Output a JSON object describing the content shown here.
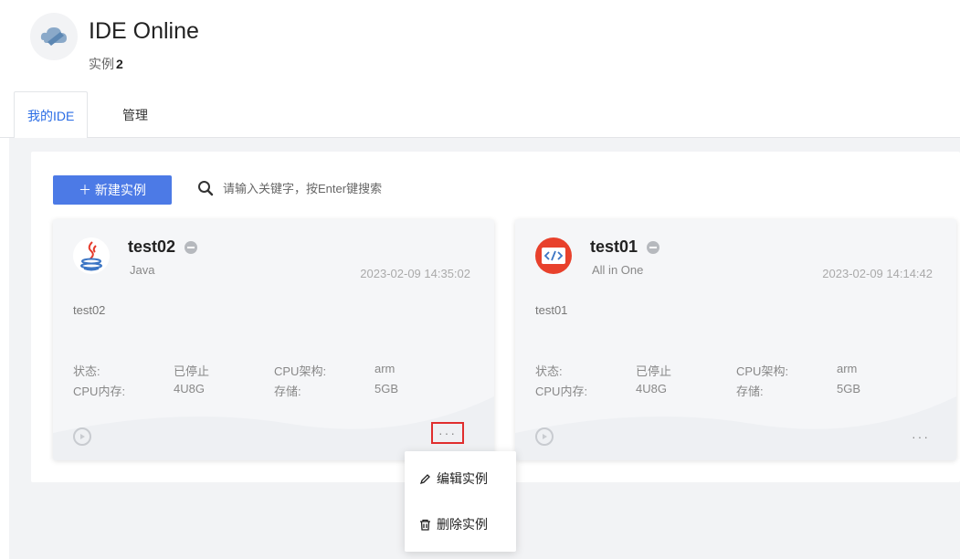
{
  "app": {
    "title": "IDE Online",
    "instances_label": "实例",
    "instances_count": "2"
  },
  "tabs": [
    {
      "label": "我的IDE"
    },
    {
      "label": "管理"
    }
  ],
  "toolbar": {
    "new_button": "＋ 新建实例",
    "search_placeholder": "请输入关键字，按Enter键搜索"
  },
  "labels": {
    "status": "状态:",
    "cpu_arch": "CPU架构:",
    "cpu_mem": "CPU内存:",
    "storage": "存储:"
  },
  "cards": [
    {
      "name": "test02",
      "type": "Java",
      "time": "2023-02-09 14:35:02",
      "desc": "test02",
      "status": "已停止",
      "cpu_arch": "arm",
      "cpu_mem": "4U8G",
      "storage": "5GB",
      "more": "···"
    },
    {
      "name": "test01",
      "type": "All in One",
      "time": "2023-02-09 14:14:42",
      "desc": "test01",
      "status": "已停止",
      "cpu_arch": "arm",
      "cpu_mem": "4U8G",
      "storage": "5GB",
      "more": "···"
    }
  ],
  "menu": {
    "edit": "编辑实例",
    "delete": "删除实例"
  },
  "colors": {
    "accent": "#2b6de5",
    "button": "#4c7ae6",
    "highlight": "#e02e2e"
  }
}
